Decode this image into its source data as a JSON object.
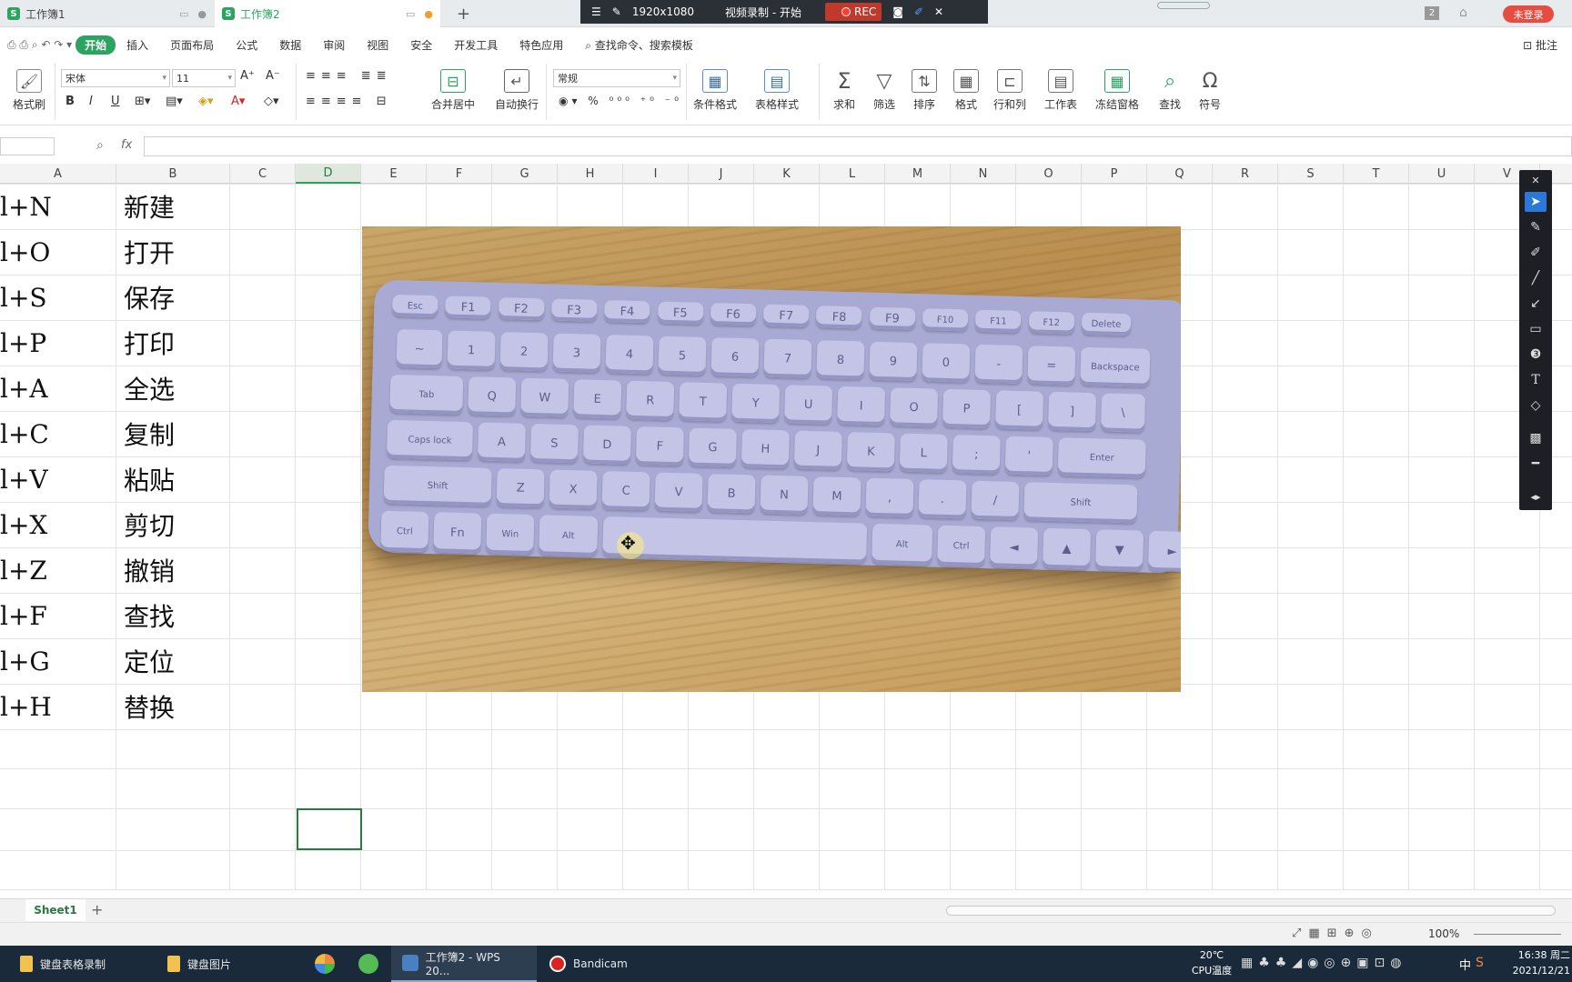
{
  "titlebar": {
    "tabs": [
      {
        "label": "工作簿1"
      },
      {
        "label": "工作簿2"
      }
    ],
    "add_tab": "+",
    "recorder": {
      "resolution": "1920x1080",
      "title": "视频录制 - 开始",
      "rec": "REC"
    },
    "page_badge": "2",
    "login": "未登录"
  },
  "menu": {
    "items": [
      "开始",
      "插入",
      "页面布局",
      "公式",
      "数据",
      "审阅",
      "视图",
      "安全",
      "开发工具",
      "特色应用"
    ],
    "search": "查找命令、搜索模板",
    "annotate": "批注"
  },
  "ribbon": {
    "format_painter": "格式刷",
    "font_name": "宋体",
    "font_size": "11",
    "merge": "合并居中",
    "wrap": "自动换行",
    "number_format": "常规",
    "cond_format": "条件格式",
    "table_style": "表格样式",
    "sum": "求和",
    "filter": "筛选",
    "sort": "排序",
    "format": "格式",
    "rowcol": "行和列",
    "worksheet": "工作表",
    "freeze": "冻结窗格",
    "find": "查找",
    "symbol": "符号"
  },
  "formula": {
    "fx": "fx"
  },
  "columns": [
    "A",
    "B",
    "C",
    "D",
    "E",
    "F",
    "G",
    "H",
    "I",
    "J",
    "K",
    "L",
    "M",
    "N",
    "O",
    "P",
    "Q",
    "R",
    "S",
    "T",
    "U",
    "V"
  ],
  "active_column": "D",
  "rows": [
    {
      "key": "l+N",
      "action": "新建"
    },
    {
      "key": "l+O",
      "action": "打开"
    },
    {
      "key": "l+S",
      "action": "保存"
    },
    {
      "key": "l+P",
      "action": "打印"
    },
    {
      "key": "l+A",
      "action": "全选"
    },
    {
      "key": "l+C",
      "action": "复制"
    },
    {
      "key": "l+V",
      "action": "粘贴"
    },
    {
      "key": "l+X",
      "action": "剪切"
    },
    {
      "key": "l+Z",
      "action": "撤销"
    },
    {
      "key": "l+F",
      "action": "查找"
    },
    {
      "key": "l+G",
      "action": "定位"
    },
    {
      "key": "l+H",
      "action": "替换"
    }
  ],
  "keyboard": {
    "fn_row": [
      "Esc",
      "F1",
      "F2",
      "F3",
      "F4",
      "F5",
      "F6",
      "F7",
      "F8",
      "F9",
      "F10",
      "F11",
      "F12",
      "Delete"
    ],
    "num_row": [
      "~",
      "1",
      "2",
      "3",
      "4",
      "5",
      "6",
      "7",
      "8",
      "9",
      "0",
      "-",
      "=",
      "Backspace"
    ],
    "q_row": [
      "Tab",
      "Q",
      "W",
      "E",
      "R",
      "T",
      "Y",
      "U",
      "I",
      "O",
      "P",
      "[",
      "]",
      "\\"
    ],
    "a_row": [
      "Caps lock",
      "A",
      "S",
      "D",
      "F",
      "G",
      "H",
      "J",
      "K",
      "L",
      ";",
      "'",
      "Enter"
    ],
    "z_row": [
      "Shift",
      "Z",
      "X",
      "C",
      "V",
      "B",
      "N",
      "M",
      ",",
      ".",
      "/",
      "Shift"
    ],
    "bottom_row": [
      "Ctrl",
      "Fn",
      "Win",
      "Alt",
      "",
      "Alt",
      "Ctrl",
      "◄",
      "▲",
      "▼",
      "►"
    ]
  },
  "sheets": {
    "active": "Sheet1",
    "add": "+"
  },
  "status": {
    "zoom": "100%"
  },
  "taskbar": {
    "items": [
      "键盘表格录制",
      "键盘图片",
      "工作簿2 - WPS 20...",
      "Bandicam"
    ],
    "temp": "20℃",
    "cpu": "CPU温度",
    "ime": "中",
    "time": "16:38 周二",
    "date": "2021/12/21"
  }
}
